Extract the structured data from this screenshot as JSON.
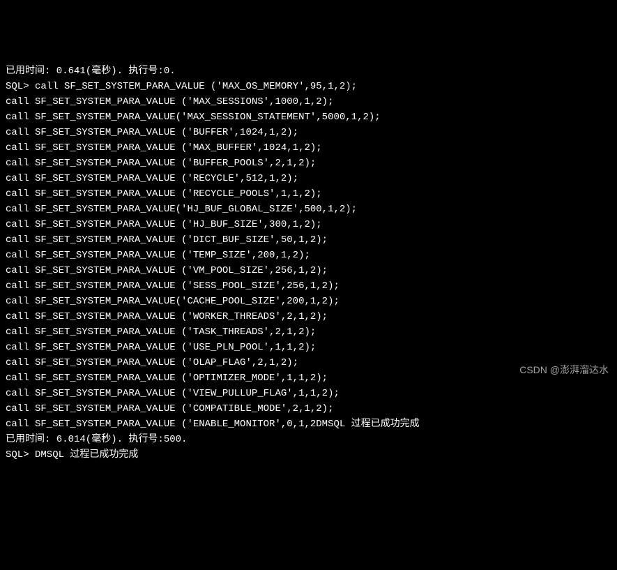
{
  "terminal": {
    "lines": [
      "已用时间: 0.641(毫秒). 执行号:0.",
      "SQL> call SF_SET_SYSTEM_PARA_VALUE ('MAX_OS_MEMORY',95,1,2);",
      "call SF_SET_SYSTEM_PARA_VALUE ('MAX_SESSIONS',1000,1,2);",
      "call SF_SET_SYSTEM_PARA_VALUE('MAX_SESSION_STATEMENT',5000,1,2);",
      "call SF_SET_SYSTEM_PARA_VALUE ('BUFFER',1024,1,2);",
      "call SF_SET_SYSTEM_PARA_VALUE ('MAX_BUFFER',1024,1,2);",
      "call SF_SET_SYSTEM_PARA_VALUE ('BUFFER_POOLS',2,1,2);",
      "call SF_SET_SYSTEM_PARA_VALUE ('RECYCLE',512,1,2);",
      "call SF_SET_SYSTEM_PARA_VALUE ('RECYCLE_POOLS',1,1,2);",
      "call SF_SET_SYSTEM_PARA_VALUE('HJ_BUF_GLOBAL_SIZE',500,1,2);",
      "call SF_SET_SYSTEM_PARA_VALUE ('HJ_BUF_SIZE',300,1,2);",
      "call SF_SET_SYSTEM_PARA_VALUE ('DICT_BUF_SIZE',50,1,2);",
      "call SF_SET_SYSTEM_PARA_VALUE ('TEMP_SIZE',200,1,2);",
      "call SF_SET_SYSTEM_PARA_VALUE ('VM_POOL_SIZE',256,1,2);",
      "call SF_SET_SYSTEM_PARA_VALUE ('SESS_POOL_SIZE',256,1,2);",
      "call SF_SET_SYSTEM_PARA_VALUE('CACHE_POOL_SIZE',200,1,2);",
      "call SF_SET_SYSTEM_PARA_VALUE ('WORKER_THREADS',2,1,2);",
      "call SF_SET_SYSTEM_PARA_VALUE ('TASK_THREADS',2,1,2);",
      "call SF_SET_SYSTEM_PARA_VALUE ('USE_PLN_POOL',1,1,2);",
      "call SF_SET_SYSTEM_PARA_VALUE ('OLAP_FLAG',2,1,2);",
      "call SF_SET_SYSTEM_PARA_VALUE ('OPTIMIZER_MODE',1,1,2);",
      "call SF_SET_SYSTEM_PARA_VALUE ('VIEW_PULLUP_FLAG',1,1,2);",
      "call SF_SET_SYSTEM_PARA_VALUE ('COMPATIBLE_MODE',2,1,2);",
      "call SF_SET_SYSTEM_PARA_VALUE ('ENABLE_MONITOR',0,1,2DMSQL 过程已成功完成",
      "已用时间: 6.014(毫秒). 执行号:500.",
      "SQL> DMSQL 过程已成功完成"
    ]
  },
  "watermark": "CSDN @澎湃溜达水"
}
